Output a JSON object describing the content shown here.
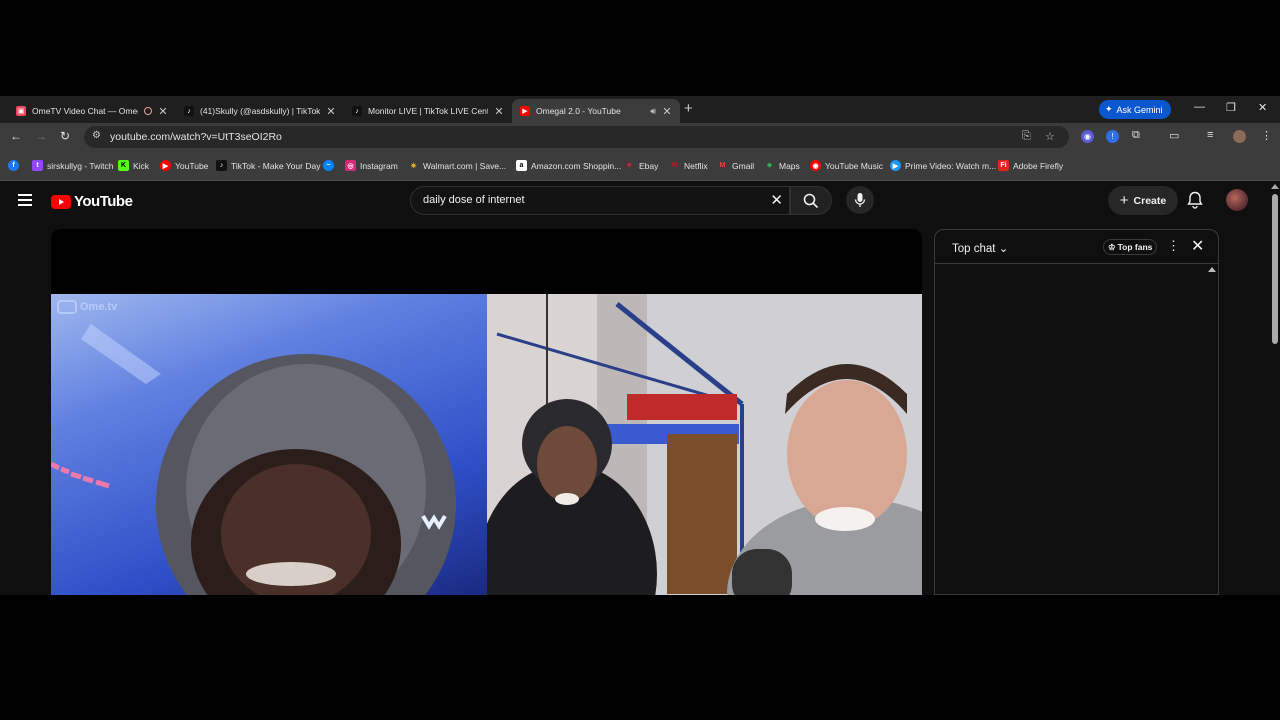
{
  "tabs": [
    {
      "title": "OmeTV Video Chat — Omeg",
      "favicon_color": "#e84a5f",
      "active": false
    },
    {
      "title": "(41)Skully (@asdskully) | TikTok",
      "favicon_color": "#111111",
      "active": false
    },
    {
      "title": "Monitor LIVE | TikTok LIVE Center",
      "favicon_color": "#111111",
      "active": false
    },
    {
      "title": "Omegal 2.0 - YouTube",
      "favicon_color": "#ff0000",
      "active": true
    }
  ],
  "gemini_label": "Ask Gemini",
  "address": {
    "url": "youtube.com/watch?v=UtT3seOI2Ro"
  },
  "bookmarks": [
    {
      "label": "sirskullyg - Twitch",
      "color": "#9146ff"
    },
    {
      "label": "Kick",
      "color": "#53fc18"
    },
    {
      "label": "YouTube",
      "color": "#ff0000"
    },
    {
      "label": "TikTok - Make Your Day",
      "color": "#111111"
    },
    {
      "label": "",
      "color": "#0084ff"
    },
    {
      "label": "Instagram",
      "color": "#d62976"
    },
    {
      "label": "Walmart.com | Save...",
      "color": "#ffc220"
    },
    {
      "label": "Amazon.com Shoppin...",
      "color": "#ffffff"
    },
    {
      "label": "Ebay",
      "color": "#e53238"
    },
    {
      "label": "Netflix",
      "color": "#e50914"
    },
    {
      "label": "Gmail",
      "color": "#ea4335"
    },
    {
      "label": "Maps",
      "color": "#34a853"
    },
    {
      "label": "YouTube Music",
      "color": "#ff0000"
    },
    {
      "label": "Prime Video: Watch m...",
      "color": "#1a98ff"
    },
    {
      "label": "Adobe Firefly",
      "color": "#e1251b"
    }
  ],
  "youtube": {
    "logo_text": "YouTube",
    "search_query": "daily dose of internet",
    "create_label": "Create"
  },
  "player": {
    "watermark": "Ome.tv"
  },
  "chat": {
    "title": "Top chat",
    "top_fans_label": "Top fans"
  },
  "colors": {
    "accent": "#0b57d0",
    "brand_red": "#ff0000"
  }
}
